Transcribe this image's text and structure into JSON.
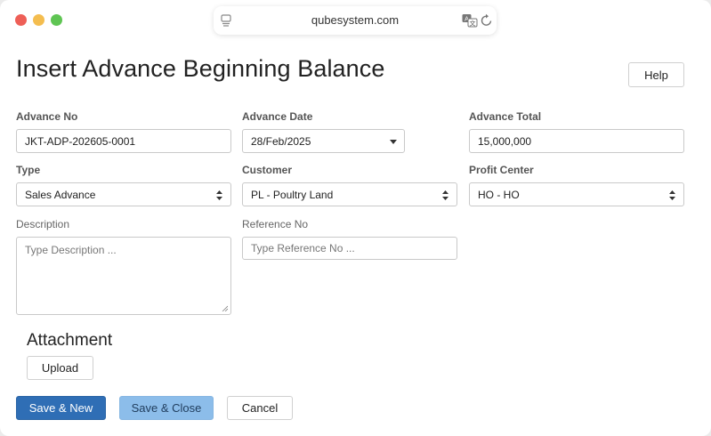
{
  "browser": {
    "url": "qubesystem.com"
  },
  "page": {
    "title": "Insert Advance Beginning Balance",
    "help_label": "Help"
  },
  "form": {
    "advance_no": {
      "label": "Advance No",
      "value": "JKT-ADP-202605-0001"
    },
    "advance_date": {
      "label": "Advance Date",
      "value": "28/Feb/2025"
    },
    "advance_total": {
      "label": "Advance Total",
      "value": "15,000,000"
    },
    "type": {
      "label": "Type",
      "value": "Sales Advance"
    },
    "customer": {
      "label": "Customer",
      "value": "PL - Poultry Land"
    },
    "profit_center": {
      "label": "Profit Center",
      "value": "HO - HO"
    },
    "description": {
      "label": "Description",
      "placeholder": "Type Description ..."
    },
    "reference_no": {
      "label": "Reference No",
      "placeholder": "Type Reference No ..."
    }
  },
  "attachment": {
    "title": "Attachment",
    "upload_label": "Upload"
  },
  "actions": {
    "save_new": "Save & New",
    "save_close": "Save & Close",
    "cancel": "Cancel"
  },
  "colors": {
    "primary": "#2f6eb5",
    "primary_light": "#8cbdea",
    "close_dot": "#ee5f57",
    "minimize_dot": "#f4bd4f",
    "zoom_dot": "#5fc553"
  },
  "icons": {
    "tab_overview": "tab-overview-icon",
    "translate": "translate-icon",
    "reload": "reload-icon",
    "date_dropdown": "chevron-down-icon",
    "select_sort": "sort-arrows-icon"
  }
}
